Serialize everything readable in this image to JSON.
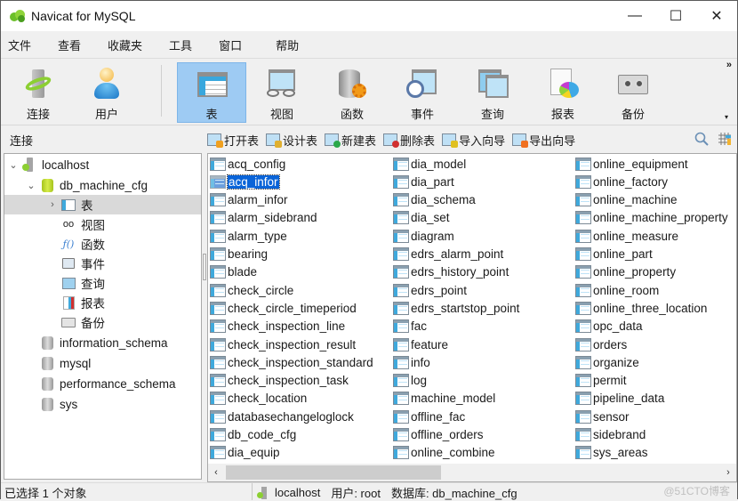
{
  "window": {
    "title": "Navicat for MySQL",
    "controls": {
      "minimize": "—",
      "maximize": "☐",
      "close": "✕"
    }
  },
  "menu": [
    "文件",
    "查看",
    "收藏夹",
    "工具",
    "窗口",
    "帮助"
  ],
  "toolbar": {
    "buttons": [
      {
        "label": "连接",
        "icon": "connection-icon"
      },
      {
        "label": "用户",
        "icon": "user-icon"
      },
      {
        "label": "表",
        "icon": "table-icon",
        "active": true
      },
      {
        "label": "视图",
        "icon": "view-icon"
      },
      {
        "label": "函数",
        "icon": "function-icon"
      },
      {
        "label": "事件",
        "icon": "event-icon"
      },
      {
        "label": "查询",
        "icon": "query-icon"
      },
      {
        "label": "报表",
        "icon": "report-icon"
      },
      {
        "label": "备份",
        "icon": "backup-icon"
      }
    ],
    "more": "»",
    "dropdown": "▾"
  },
  "connection_header": "连接",
  "object_toolbar": [
    {
      "label": "打开表",
      "badge_color": "#f0a020"
    },
    {
      "label": "设计表",
      "badge_color": "#e0b030"
    },
    {
      "label": "新建表",
      "badge_color": "#2aa84a"
    },
    {
      "label": "删除表",
      "badge_color": "#d03030"
    },
    {
      "label": "导入向导",
      "badge_color": "#e0c020"
    },
    {
      "label": "导出向导",
      "badge_color": "#f07020"
    }
  ],
  "tree": {
    "connection": "localhost",
    "database": "db_machine_cfg",
    "db_children": [
      {
        "label": "表",
        "icon": "table-icon",
        "selected": true,
        "expandable": true
      },
      {
        "label": "视图",
        "icon": "view-icon"
      },
      {
        "label": "函数",
        "icon": "function-icon"
      },
      {
        "label": "事件",
        "icon": "event-icon"
      },
      {
        "label": "查询",
        "icon": "query-icon"
      },
      {
        "label": "报表",
        "icon": "report-icon"
      },
      {
        "label": "备份",
        "icon": "backup-icon"
      }
    ],
    "other_databases": [
      "information_schema",
      "mysql",
      "performance_schema",
      "sys"
    ]
  },
  "tables": [
    [
      "acq_config",
      "acq_infor",
      "alarm_infor",
      "alarm_sidebrand",
      "alarm_type",
      "bearing",
      "blade",
      "check_circle",
      "check_circle_timeperiod",
      "check_inspection_line",
      "check_inspection_result",
      "check_inspection_standard",
      "check_inspection_task",
      "check_location",
      "databasechangeloglock",
      "db_code_cfg",
      "dia_equip"
    ],
    [
      "dia_model",
      "dia_part",
      "dia_schema",
      "dia_set",
      "diagram",
      "edrs_alarm_point",
      "edrs_history_point",
      "edrs_point",
      "edrs_startstop_point",
      "fac",
      "feature",
      "info",
      "log",
      "machine_model",
      "offline_fac",
      "offline_orders",
      "online_combine"
    ],
    [
      "online_equipment",
      "online_factory",
      "online_machine",
      "online_machine_property",
      "online_measure",
      "online_part",
      "online_property",
      "online_room",
      "online_three_location",
      "opc_data",
      "orders",
      "organize",
      "permit",
      "pipeline_data",
      "sensor",
      "sidebrand",
      "sys_areas"
    ]
  ],
  "selected_table": "acq_infor",
  "status": {
    "selection": "已选择 1 个对象",
    "host": "localhost",
    "user": "用户: root",
    "database": "数据库: db_machine_cfg",
    "watermark": "@51CTO博客"
  },
  "colors": {
    "active_tool_bg": "#9ecbf3",
    "selection_bg": "#0a64d8",
    "tree_selection_bg": "#d9d9d9"
  }
}
